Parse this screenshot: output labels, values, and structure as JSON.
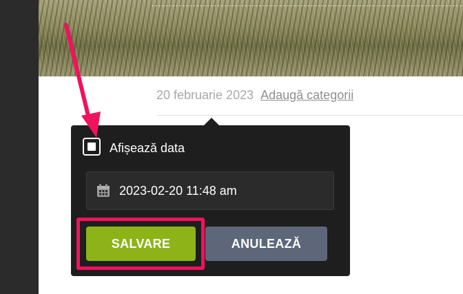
{
  "post_meta": {
    "date": "20 februarie 2023",
    "categories_link": "Adaugă categorii"
  },
  "popover": {
    "show_date_label": "Afișează data",
    "show_date_checked": false,
    "date_value": "2023-02-20 11:48 am",
    "save_label": "SALVARE",
    "cancel_label": "ANULEAZĂ"
  },
  "icons": {
    "calendar": "calendar-icon",
    "checkbox": "checkbox-icon"
  },
  "colors": {
    "popover_bg": "#1e1e1e",
    "save_button": "#8db319",
    "cancel_button": "#5d6779",
    "annotation": "#f0125d"
  }
}
